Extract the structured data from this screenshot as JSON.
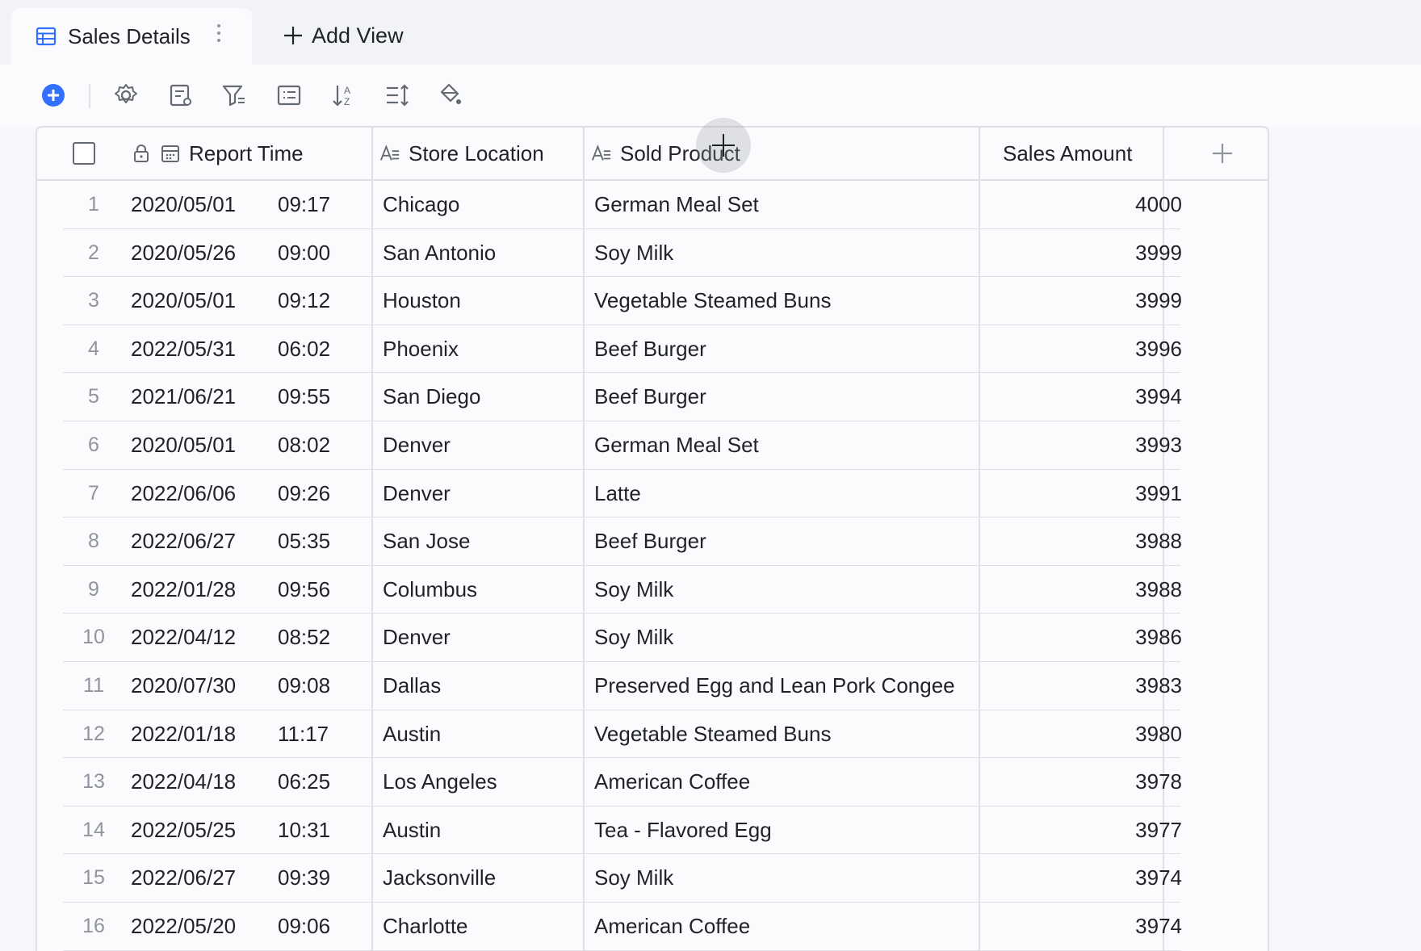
{
  "tabs": {
    "active_label": "Sales Details",
    "add_view_label": "Add View"
  },
  "toolbar": {
    "items": [
      "add-record-icon",
      "settings-icon",
      "form-icon",
      "filter-icon",
      "group-icon",
      "sort-icon",
      "row-height-icon",
      "fill-color-icon"
    ]
  },
  "columns": {
    "report_time": "Report Time",
    "store_location": "Store Location",
    "sold_product": "Sold Product",
    "sales_amount": "Sales Amount"
  },
  "colors": {
    "accent": "#3370ff",
    "border": "#dee0e3",
    "text": "#1f2329",
    "muted": "#8f959e"
  },
  "rows": [
    {
      "index": "1",
      "date": "2020/05/01",
      "time": "09:17",
      "location": "Chicago",
      "product": "German Meal Set",
      "amount": "4000"
    },
    {
      "index": "2",
      "date": "2020/05/26",
      "time": "09:00",
      "location": "San Antonio",
      "product": "Soy Milk",
      "amount": "3999"
    },
    {
      "index": "3",
      "date": "2020/05/01",
      "time": "09:12",
      "location": "Houston",
      "product": "Vegetable Steamed Buns",
      "amount": "3999"
    },
    {
      "index": "4",
      "date": "2022/05/31",
      "time": "06:02",
      "location": "Phoenix",
      "product": "Beef Burger",
      "amount": "3996"
    },
    {
      "index": "5",
      "date": "2021/06/21",
      "time": "09:55",
      "location": "San Diego",
      "product": "Beef Burger",
      "amount": "3994"
    },
    {
      "index": "6",
      "date": "2020/05/01",
      "time": "08:02",
      "location": "Denver",
      "product": "German Meal Set",
      "amount": "3993"
    },
    {
      "index": "7",
      "date": "2022/06/06",
      "time": "09:26",
      "location": "Denver",
      "product": "Latte",
      "amount": "3991"
    },
    {
      "index": "8",
      "date": "2022/06/27",
      "time": "05:35",
      "location": "San Jose",
      "product": "Beef Burger",
      "amount": "3988"
    },
    {
      "index": "9",
      "date": "2022/01/28",
      "time": "09:56",
      "location": "Columbus",
      "product": "Soy Milk",
      "amount": "3988"
    },
    {
      "index": "10",
      "date": "2022/04/12",
      "time": "08:52",
      "location": "Denver",
      "product": "Soy Milk",
      "amount": "3986"
    },
    {
      "index": "11",
      "date": "2020/07/30",
      "time": "09:08",
      "location": "Dallas",
      "product": "Preserved Egg and Lean Pork Congee",
      "amount": "3983"
    },
    {
      "index": "12",
      "date": "2022/01/18",
      "time": "11:17",
      "location": "Austin",
      "product": "Vegetable Steamed Buns",
      "amount": "3980"
    },
    {
      "index": "13",
      "date": "2022/04/18",
      "time": "06:25",
      "location": "Los Angeles",
      "product": "American Coffee",
      "amount": "3978"
    },
    {
      "index": "14",
      "date": "2022/05/25",
      "time": "10:31",
      "location": "Austin",
      "product": "Tea - Flavored Egg",
      "amount": "3977"
    },
    {
      "index": "15",
      "date": "2022/06/27",
      "time": "09:39",
      "location": "Jacksonville",
      "product": "Soy Milk",
      "amount": "3974"
    },
    {
      "index": "16",
      "date": "2022/05/20",
      "time": "09:06",
      "location": "Charlotte",
      "product": "American Coffee",
      "amount": "3974"
    }
  ]
}
